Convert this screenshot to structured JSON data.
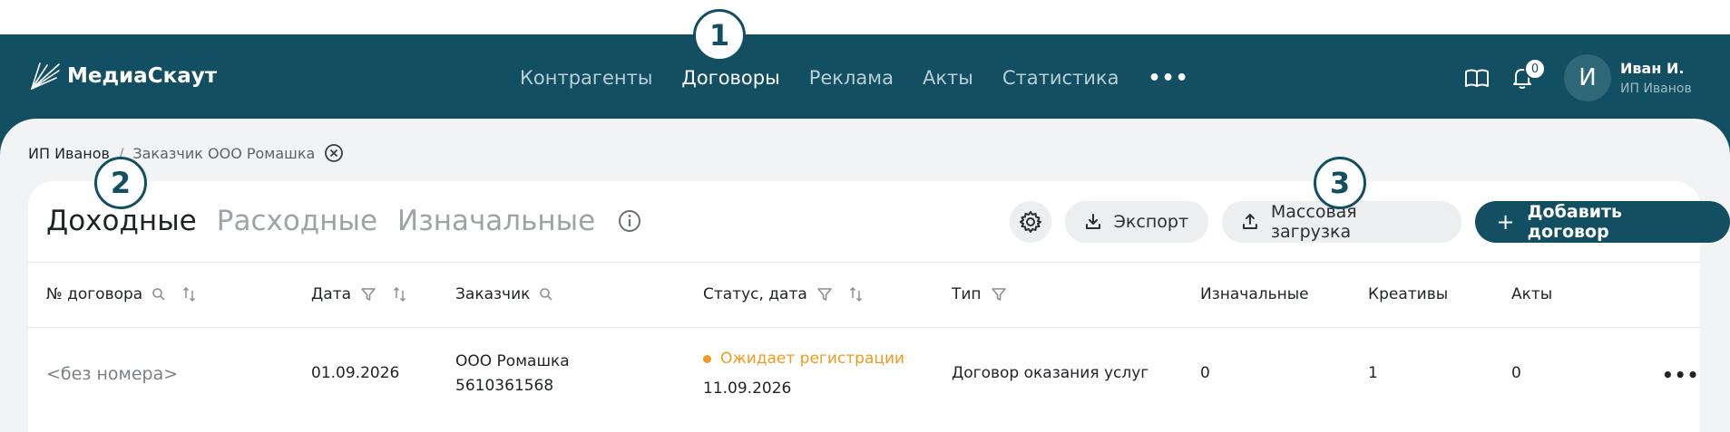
{
  "header": {
    "logo_text": "МедиаСкаут",
    "nav": [
      {
        "label": "Контрагенты",
        "active": false
      },
      {
        "label": "Договоры",
        "active": true
      },
      {
        "label": "Реклама",
        "active": false
      },
      {
        "label": "Акты",
        "active": false
      },
      {
        "label": "Статистика",
        "active": false
      }
    ],
    "nav_more_label": "•••",
    "notifications_count": "0",
    "user": {
      "avatar_letter": "И",
      "name": "Иван И.",
      "org": "ИП Иванов"
    }
  },
  "breadcrumb": {
    "items": [
      "ИП Иванов",
      "Заказчик ООО Ромашка"
    ],
    "separator": "/"
  },
  "tabs": [
    {
      "label": "Доходные",
      "active": true
    },
    {
      "label": "Расходные",
      "active": false
    },
    {
      "label": "Изначальные",
      "active": false
    }
  ],
  "actions": {
    "export_label": "Экспорт",
    "bulk_upload_label": "Массовая загрузка",
    "add_contract_label": "Добавить договор",
    "add_symbol": "+"
  },
  "table": {
    "columns": [
      "№ договора",
      "Дата",
      "Заказчик",
      "Статус, дата",
      "Тип",
      "Изначальные",
      "Креативы",
      "Акты"
    ],
    "rows": [
      {
        "number": "<без номера>",
        "date": "01.09.2026",
        "customer_name": "ООО Ромашка",
        "customer_inn": "5610361568",
        "status": "Ожидает регистрации",
        "status_date": "11.09.2026",
        "type": "Договор оказания услуг",
        "initial": "0",
        "creatives": "1",
        "acts": "0",
        "menu": "•••"
      }
    ]
  },
  "callouts": [
    "1",
    "2",
    "3"
  ],
  "colors": {
    "brand": "#124f62",
    "status_pending": "#f29a1f",
    "background": "#f2f3f4"
  }
}
